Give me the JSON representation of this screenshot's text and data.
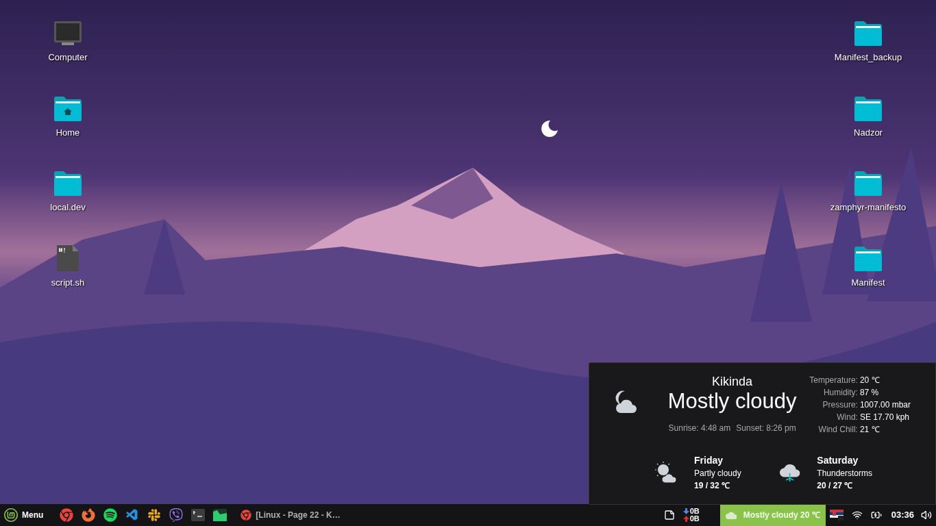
{
  "desktop": {
    "left_icons": [
      {
        "label": "Computer",
        "kind": "computer"
      },
      {
        "label": "Home",
        "kind": "home"
      },
      {
        "label": "local.dev",
        "kind": "folder"
      },
      {
        "label": "script.sh",
        "kind": "script"
      }
    ],
    "right_icons": [
      {
        "label": "Manifest_backup",
        "kind": "folder"
      },
      {
        "label": "Nadzor",
        "kind": "folder"
      },
      {
        "label": "zamphyr-manifesto",
        "kind": "folder"
      },
      {
        "label": "Manifest",
        "kind": "folder"
      }
    ]
  },
  "weather": {
    "city": "Kikinda",
    "condition": "Mostly cloudy",
    "sunrise": "Sunrise: 4:48 am",
    "sunset": "Sunset: 8:26 pm",
    "details": [
      {
        "label": "Temperature:",
        "value": "20 ℃"
      },
      {
        "label": "Humidity:",
        "value": "87 %"
      },
      {
        "label": "Pressure:",
        "value": "1007.00 mbar"
      },
      {
        "label": "Wind:",
        "value": "SE 17.70 kph"
      },
      {
        "label": "Wind Chill:",
        "value": "21 ℃"
      }
    ],
    "forecast": [
      {
        "day": "Friday",
        "condition": "Partly cloudy",
        "temps": "19 / 32 ℃",
        "kind": "partly-cloudy"
      },
      {
        "day": "Saturday",
        "condition": "Thunderstorms",
        "temps": "20 / 27 ℃",
        "kind": "thunderstorm"
      }
    ]
  },
  "taskbar": {
    "menu_label": "Menu",
    "launchers": [
      {
        "kind": "chrome"
      },
      {
        "kind": "firefox"
      },
      {
        "kind": "spotify"
      },
      {
        "kind": "vscode"
      },
      {
        "kind": "slack"
      },
      {
        "kind": "viber"
      },
      {
        "kind": "terminal"
      },
      {
        "kind": "monitor"
      }
    ],
    "window_button": {
      "title": "[Linux - Page 22 - K…"
    },
    "net_down": "0B",
    "net_up": "0B",
    "weather_applet": "Mostly cloudy 20 ℃",
    "clock": "03:36"
  }
}
